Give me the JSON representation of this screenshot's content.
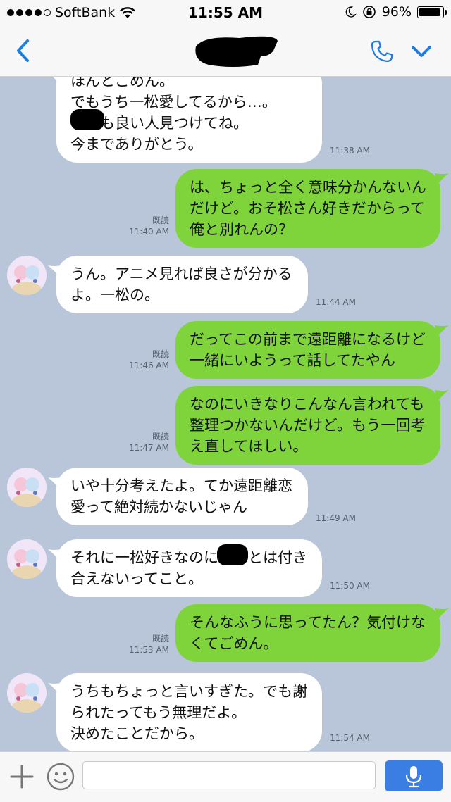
{
  "status": {
    "carrier": "SoftBank",
    "time": "11:55 AM",
    "battery": "96%",
    "battery_level": 0.96
  },
  "nav": {
    "back_icon": "chevron-left-icon",
    "call_icon": "phone-icon",
    "menu_icon": "chevron-down-icon"
  },
  "messages": [
    {
      "dir": "in",
      "text": "ほんとごめん。\nでもうち一松愛してるから…。\n　　も良い人見つけてね。\n今までありがとう。",
      "time": "11:38 AM"
    },
    {
      "dir": "out",
      "text": "は、ちょっと全く意味分かんないん\nだけど。おそ松さん好きだからって\n俺と別れんの？",
      "time": "11:40 AM",
      "read": "既読"
    },
    {
      "dir": "in",
      "text": "うん。アニメ見れば良さが分かる\nよ。一松の。",
      "time": "11:44 AM"
    },
    {
      "dir": "out",
      "text": "だってこの前まで遠距離になるけど\n一緒にいようって話してたやん",
      "time": "11:46 AM",
      "read": "既読"
    },
    {
      "dir": "out",
      "text": "なのにいきなりこんなん言われても\n整理つかないんだけど。もう一回考\nえ直してほしい。",
      "time": "11:47 AM",
      "read": "既読"
    },
    {
      "dir": "in",
      "text": "いや十分考えたよ。てか遠距離恋\n愛って絶対続かないじゃん",
      "time": "11:49 AM"
    },
    {
      "dir": "in",
      "text": "それに一松好きなのに　　とは付き\n合えないってこと。",
      "time": "11:50 AM"
    },
    {
      "dir": "out",
      "text": "そんなふうに思ってたん？気付けな\nくてごめん。",
      "time": "11:53 AM",
      "read": "既読"
    },
    {
      "dir": "in",
      "text": "うちもちょっと言いすぎた。でも謝\nられたってもう無理だよ。\n決めたことだから。",
      "time": "11:54 AM"
    }
  ],
  "composer": {
    "placeholder": "",
    "plus_icon": "plus-icon",
    "emoji_icon": "smiley-icon",
    "mic_icon": "microphone-icon"
  },
  "colors": {
    "chat_bg": "#b9c6da",
    "outgoing": "#7fd43c",
    "incoming": "#ffffff",
    "accent": "#1f7ce0"
  }
}
